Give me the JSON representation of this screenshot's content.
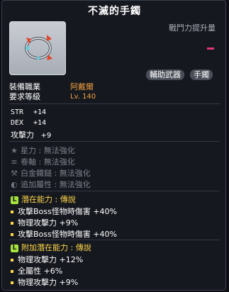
{
  "item": {
    "name": "不滅的手鐲",
    "power_label": "戰鬥力提升量",
    "tags": [
      "輔助武器",
      "手鐲"
    ]
  },
  "requirements": {
    "job_label": "裝備職業",
    "job_value": "阿戴爾",
    "level_label": "要求等級",
    "level_value": "Lv. 140"
  },
  "stats": [
    {
      "label": "STR",
      "value": "+14"
    },
    {
      "label": "DEX",
      "value": "+14"
    },
    {
      "label": "攻擊力",
      "value": "+9"
    }
  ],
  "enhancements": [
    {
      "icon": "star-icon",
      "glyph": "★",
      "text": "星力 : 無法強化"
    },
    {
      "icon": "scroll-icon",
      "glyph": "≡",
      "text": "卷軸 : 無法強化"
    },
    {
      "icon": "hammer-icon",
      "glyph": "⚒",
      "text": "白金鐵鎚 : 無法強化"
    },
    {
      "icon": "flame-icon",
      "glyph": "◐",
      "text": "追加屬性 : 無法強化"
    }
  ],
  "potential": {
    "badge": "L",
    "heading": "潛在能力 : 傳說",
    "lines": [
      "攻擊Boss怪物時傷害 +40%",
      "物理攻擊力 +9%",
      "攻擊Boss怪物時傷害 +40%"
    ]
  },
  "additional_potential": {
    "badge": "L",
    "heading": "附加潛在能力 : 傳說",
    "lines": [
      "物理攻擊力 +12%",
      "全屬性 +6%",
      "物理攻擊力 +9%"
    ]
  },
  "colors": {
    "accent_gold": "#ffd84a",
    "legend_badge": "#a6e33a",
    "value_orange": "#f0a040",
    "power_bar": "#e0357a"
  }
}
